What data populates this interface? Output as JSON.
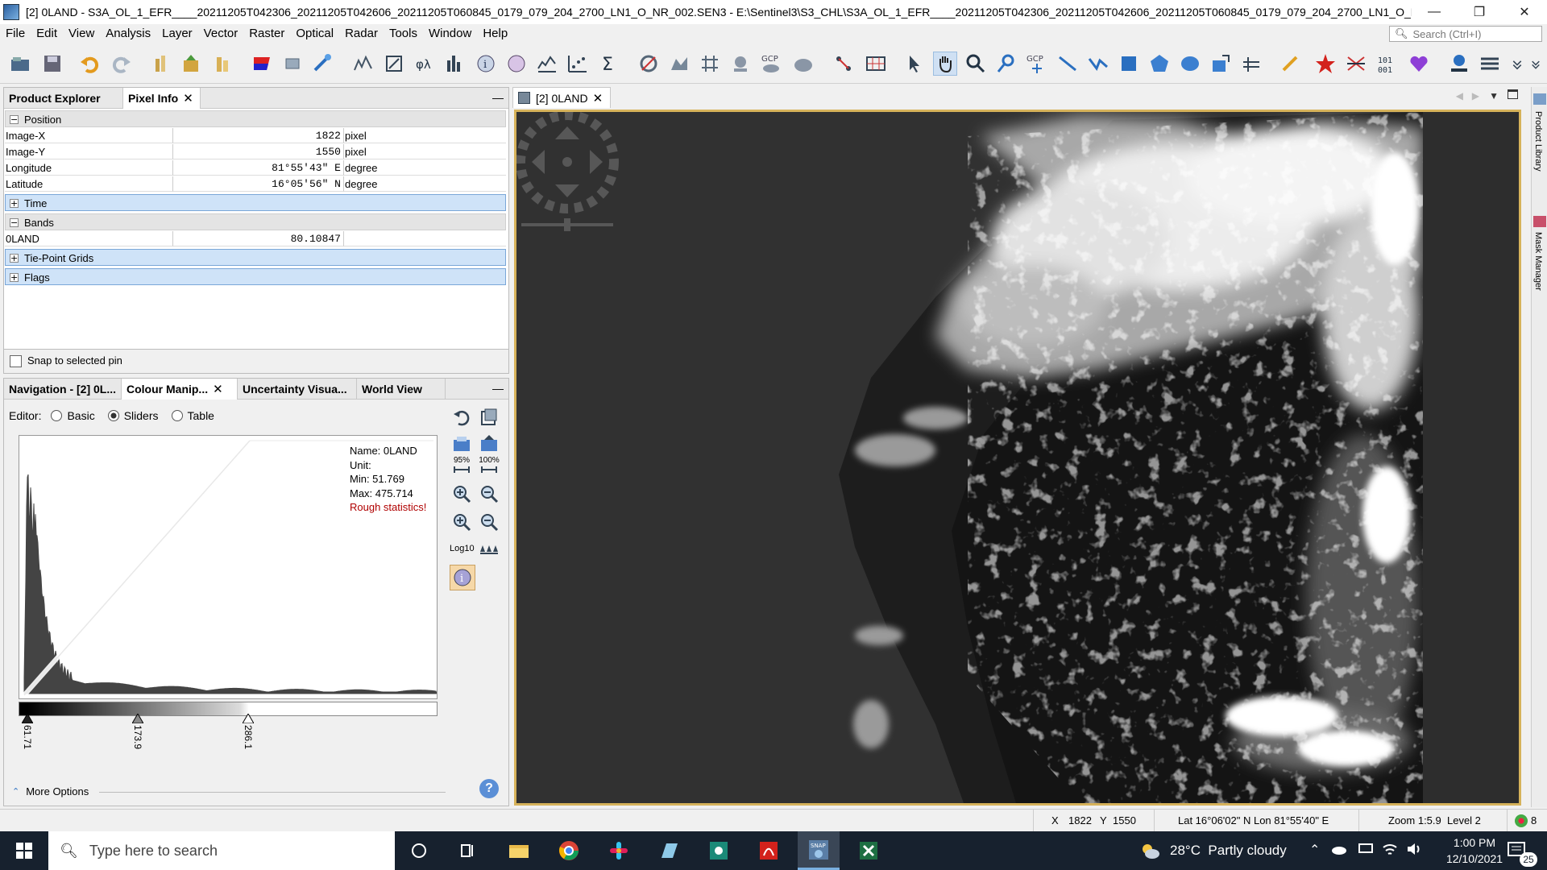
{
  "window": {
    "title": "[2] 0LAND - S3A_OL_1_EFR____20211205T042306_20211205T042606_20211205T060845_0179_079_204_2700_LN1_O_NR_002.SEN3 - E:\\Sentinel3\\S3_CHL\\S3A_OL_1_EFR____20211205T042306_20211205T042606_20211205T060845_0179_079_204_2700_LN1_O_N...",
    "minimize": "—",
    "restore": "❐",
    "close": "✕"
  },
  "menu": [
    "File",
    "Edit",
    "View",
    "Analysis",
    "Layer",
    "Vector",
    "Raster",
    "Optical",
    "Radar",
    "Tools",
    "Window",
    "Help"
  ],
  "search": {
    "placeholder": "Search (Ctrl+I)"
  },
  "toolbar": {
    "gcp_label": "GCP",
    "gcp2_label": "GCP"
  },
  "top_panel": {
    "tabs": [
      {
        "label": "Product Explorer"
      },
      {
        "label": "Pixel Info",
        "close": "✕"
      }
    ],
    "minimize": "—"
  },
  "pixel_info": {
    "position_group": "Position",
    "rows": [
      {
        "name": "Image-X",
        "value": "1822",
        "unit": "pixel"
      },
      {
        "name": "Image-Y",
        "value": "1550",
        "unit": "pixel"
      },
      {
        "name": "Longitude",
        "value": "81°55'43\" E",
        "unit": "degree"
      },
      {
        "name": "Latitude",
        "value": "16°05'56\" N",
        "unit": "degree"
      }
    ],
    "time_group": "Time",
    "bands_group": "Bands",
    "band_row": {
      "name": "0LAND",
      "value": "80.10847",
      "unit": ""
    },
    "tiepoint_group": "Tie-Point Grids",
    "flags_group": "Flags",
    "snap_label": "Snap to selected pin",
    "snap_checked": false
  },
  "bottom_panel": {
    "tabs": [
      {
        "label": "Navigation - [2] 0L..."
      },
      {
        "label": "Colour Manip...",
        "close": "✕"
      },
      {
        "label": "Uncertainty Visua..."
      },
      {
        "label": "World View"
      }
    ],
    "minimize": "—"
  },
  "colour_manip": {
    "editor_label": "Editor:",
    "options": [
      "Basic",
      "Sliders",
      "Table"
    ],
    "selected": "Sliders",
    "info": {
      "name": "Name: 0LAND",
      "unit": "Unit:",
      "min": "Min: 51.769",
      "max": "Max: 475.714",
      "warning": "Rough statistics!"
    },
    "sliders": [
      "61.71",
      "173.9",
      "286.1"
    ],
    "pct95": "95%",
    "pct100": "100%",
    "log_label": "Log10",
    "more_options": "More Options"
  },
  "image_view": {
    "tab_label": "[2] 0LAND",
    "tab_close": "✕"
  },
  "right_sidebar": [
    "Product Library",
    "Mask Manager"
  ],
  "statusbar": {
    "x_label": "X",
    "x_value": "1822",
    "y_label": "Y",
    "y_value": "1550",
    "latlon": "Lat 16°06'02\" N Lon 81°55'40\" E",
    "zoom": "Zoom 1:5.9  Level 2",
    "count": "8"
  },
  "taskbar": {
    "search_placeholder": "Type here to search",
    "weather": "28°C  Partly cloudy",
    "time": "1:00 PM",
    "date": "12/10/2021",
    "notifications": "25"
  },
  "colors": {
    "accent": "#d6b25a",
    "warning": "#b00000",
    "selection": "#cfe3f8",
    "taskbar": "#17212e"
  }
}
